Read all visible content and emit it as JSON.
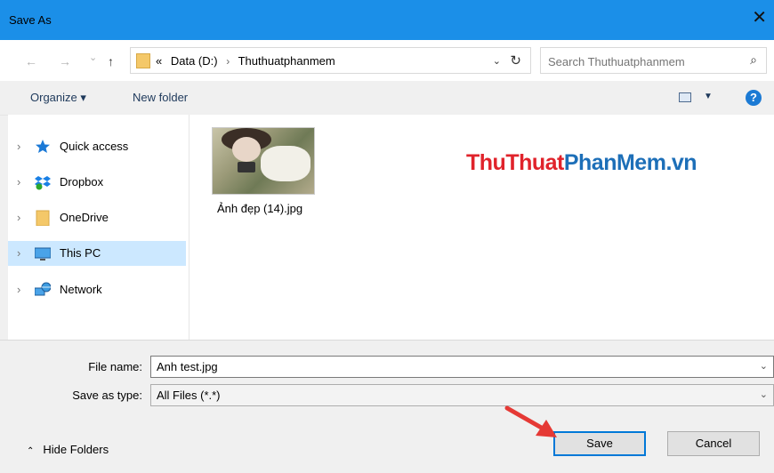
{
  "window": {
    "title": "Save As",
    "close_glyph": "✕"
  },
  "address_bar": {
    "back_glyph": "←",
    "forward_glyph": "→",
    "recent_glyph": "⌄",
    "up_glyph": "↑",
    "overflow": "«",
    "crumbs": [
      "Data (D:)",
      "Thuthuatphanmem"
    ],
    "separator": "›",
    "dropdown_glyph": "⌄",
    "refresh_glyph": "↻",
    "search_placeholder": "Search Thuthuatphanmem",
    "search_glyph": "⌕"
  },
  "toolbar": {
    "organize_label": "Organize ▾",
    "new_folder_label": "New folder",
    "view_dropdown_glyph": "▼",
    "help_glyph": "?"
  },
  "nav_pane": {
    "items": [
      {
        "label": "Quick access",
        "icon": "star-icon",
        "selected": false
      },
      {
        "label": "Dropbox",
        "icon": "dropbox-icon",
        "selected": false
      },
      {
        "label": "OneDrive",
        "icon": "folder-icon",
        "selected": false
      },
      {
        "label": "This PC",
        "icon": "monitor-icon",
        "selected": true
      },
      {
        "label": "Network",
        "icon": "network-icon",
        "selected": false
      }
    ],
    "chevron_glyph": "›"
  },
  "content": {
    "files": [
      {
        "name": "Ảnh đẹp (14).jpg"
      }
    ],
    "watermark": {
      "part1": "ThuThuat",
      "part2": "PhanMem",
      "part3": ".vn",
      "color1": "#e0232b",
      "color2": "#1d6fb8",
      "color3": "#1d6fb8"
    }
  },
  "bottom": {
    "file_name_label": "File name:",
    "file_name_value": "Anh test.jpg",
    "save_type_label": "Save as type:",
    "save_type_value": "All Files (*.*)",
    "dropdown_glyph": "⌄",
    "hide_folders_label": "Hide Folders",
    "hide_folders_glyph": "⌃",
    "save_button": "Save",
    "cancel_button": "Cancel"
  },
  "colors": {
    "titlebar": "#1b8fe8",
    "accent": "#0078d7",
    "selected": "#cce8ff",
    "arrow": "#e53935"
  }
}
